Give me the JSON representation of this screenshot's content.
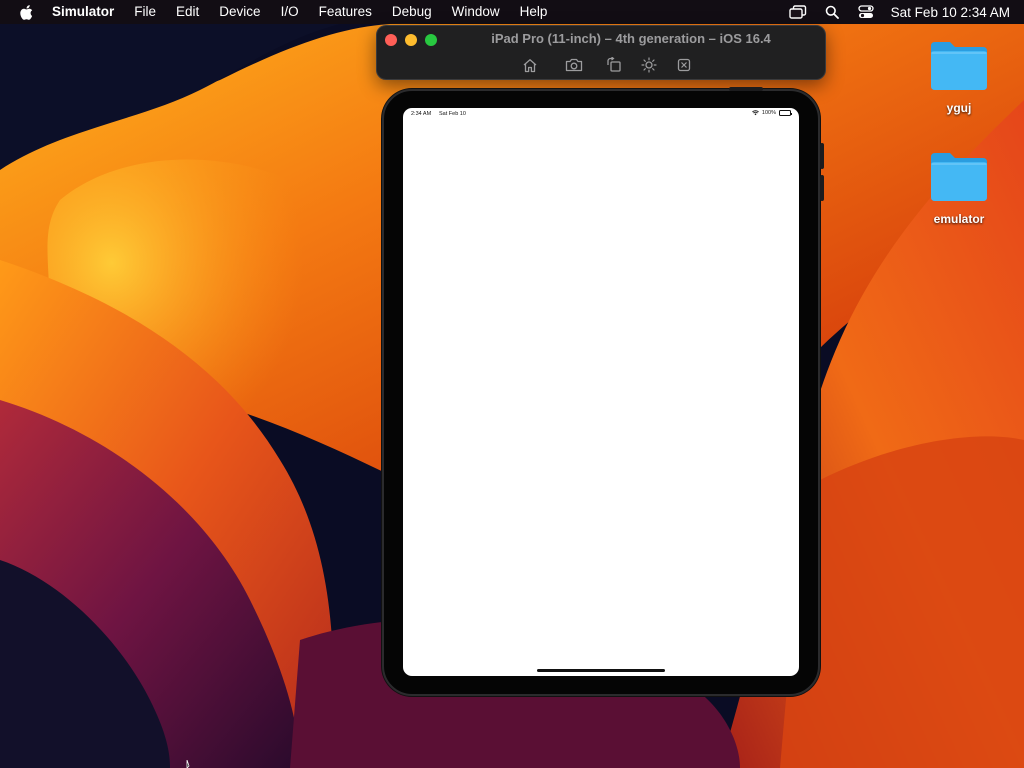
{
  "menubar": {
    "app_name": "Simulator",
    "items": [
      "File",
      "Edit",
      "Device",
      "I/O",
      "Features",
      "Debug",
      "Window",
      "Help"
    ],
    "clock": "Sat Feb 10  2:34 AM",
    "status_icons": [
      "screen-mirroring-icon",
      "spotlight-search-icon",
      "control-center-icon"
    ]
  },
  "simulator": {
    "title": "iPad Pro (11-inch) – 4th generation – iOS 16.4",
    "tools": [
      "home-icon",
      "screenshot-icon",
      "rotate-icon",
      "appearance-icon",
      "device-settings-icon"
    ]
  },
  "ipad": {
    "status_time": "2:34 AM",
    "status_date": "Sat Feb 10",
    "battery": "100%",
    "battery_level": 1.0
  },
  "desktop": {
    "icons": [
      {
        "label": "yguj",
        "icon": "folder-icon"
      },
      {
        "label": "emulator",
        "icon": "folder-icon"
      }
    ]
  },
  "colors": {
    "folder": "#3ab4f2",
    "close": "#ff5f57",
    "minimize": "#febc2e",
    "zoom": "#28c840",
    "wallpaper_orange": "#f26a10",
    "wallpaper_yellow": "#ffb11a",
    "wallpaper_purple": "#6a1240"
  }
}
